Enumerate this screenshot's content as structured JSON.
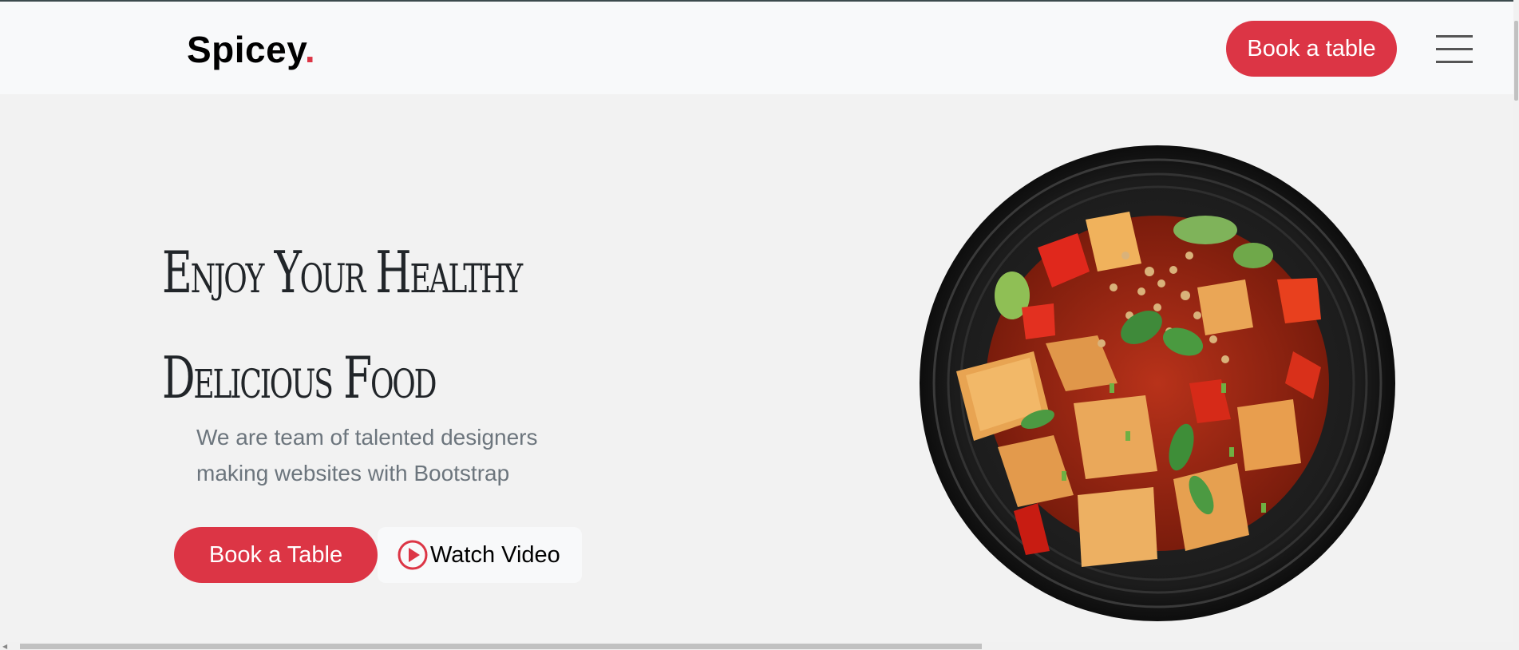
{
  "header": {
    "logo_text": "Spicey",
    "logo_dot": ".",
    "book_button_label": "Book a table",
    "menu_icon": "hamburger-menu-icon"
  },
  "hero": {
    "title_line1": "Enjoy Your Healthy",
    "title_line2": "Delicious Food",
    "subtitle_line1": "We are team of talented designers",
    "subtitle_line2": "making websites with Bootstrap",
    "book_button_label": "Book a Table",
    "video_button_label": "Watch Video",
    "video_icon": "play-circle-icon"
  },
  "image": {
    "subject": "dish-image"
  },
  "colors": {
    "accent": "#dc3545",
    "heading": "#212529",
    "muted": "#6c757d",
    "header_bg": "#f8f9fa",
    "page_bg": "#f2f2f2"
  }
}
